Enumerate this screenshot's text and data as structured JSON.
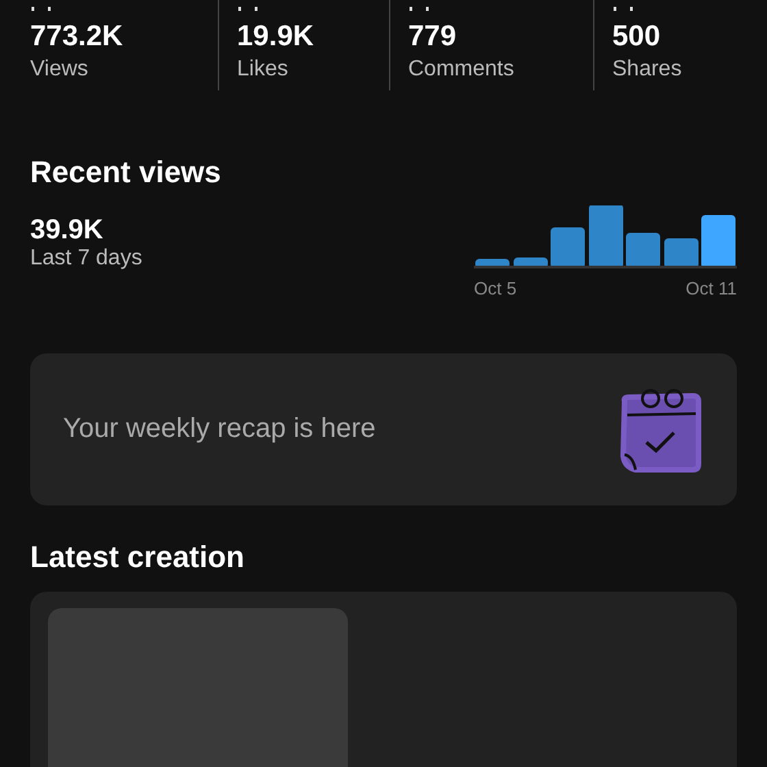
{
  "stats": [
    {
      "value": "773.2K",
      "label": "Views"
    },
    {
      "value": "19.9K",
      "label": "Likes"
    },
    {
      "value": "779",
      "label": "Comments"
    },
    {
      "value": "500",
      "label": "Shares"
    }
  ],
  "recent_views": {
    "title": "Recent views",
    "total": "39.9K",
    "period": "Last 7 days",
    "axis_start": "Oct 5",
    "axis_end": "Oct 11"
  },
  "recap": {
    "text": "Your weekly recap is here"
  },
  "latest": {
    "title": "Latest creation",
    "thumbnail": {
      "kind": "placeholder"
    }
  }
}
